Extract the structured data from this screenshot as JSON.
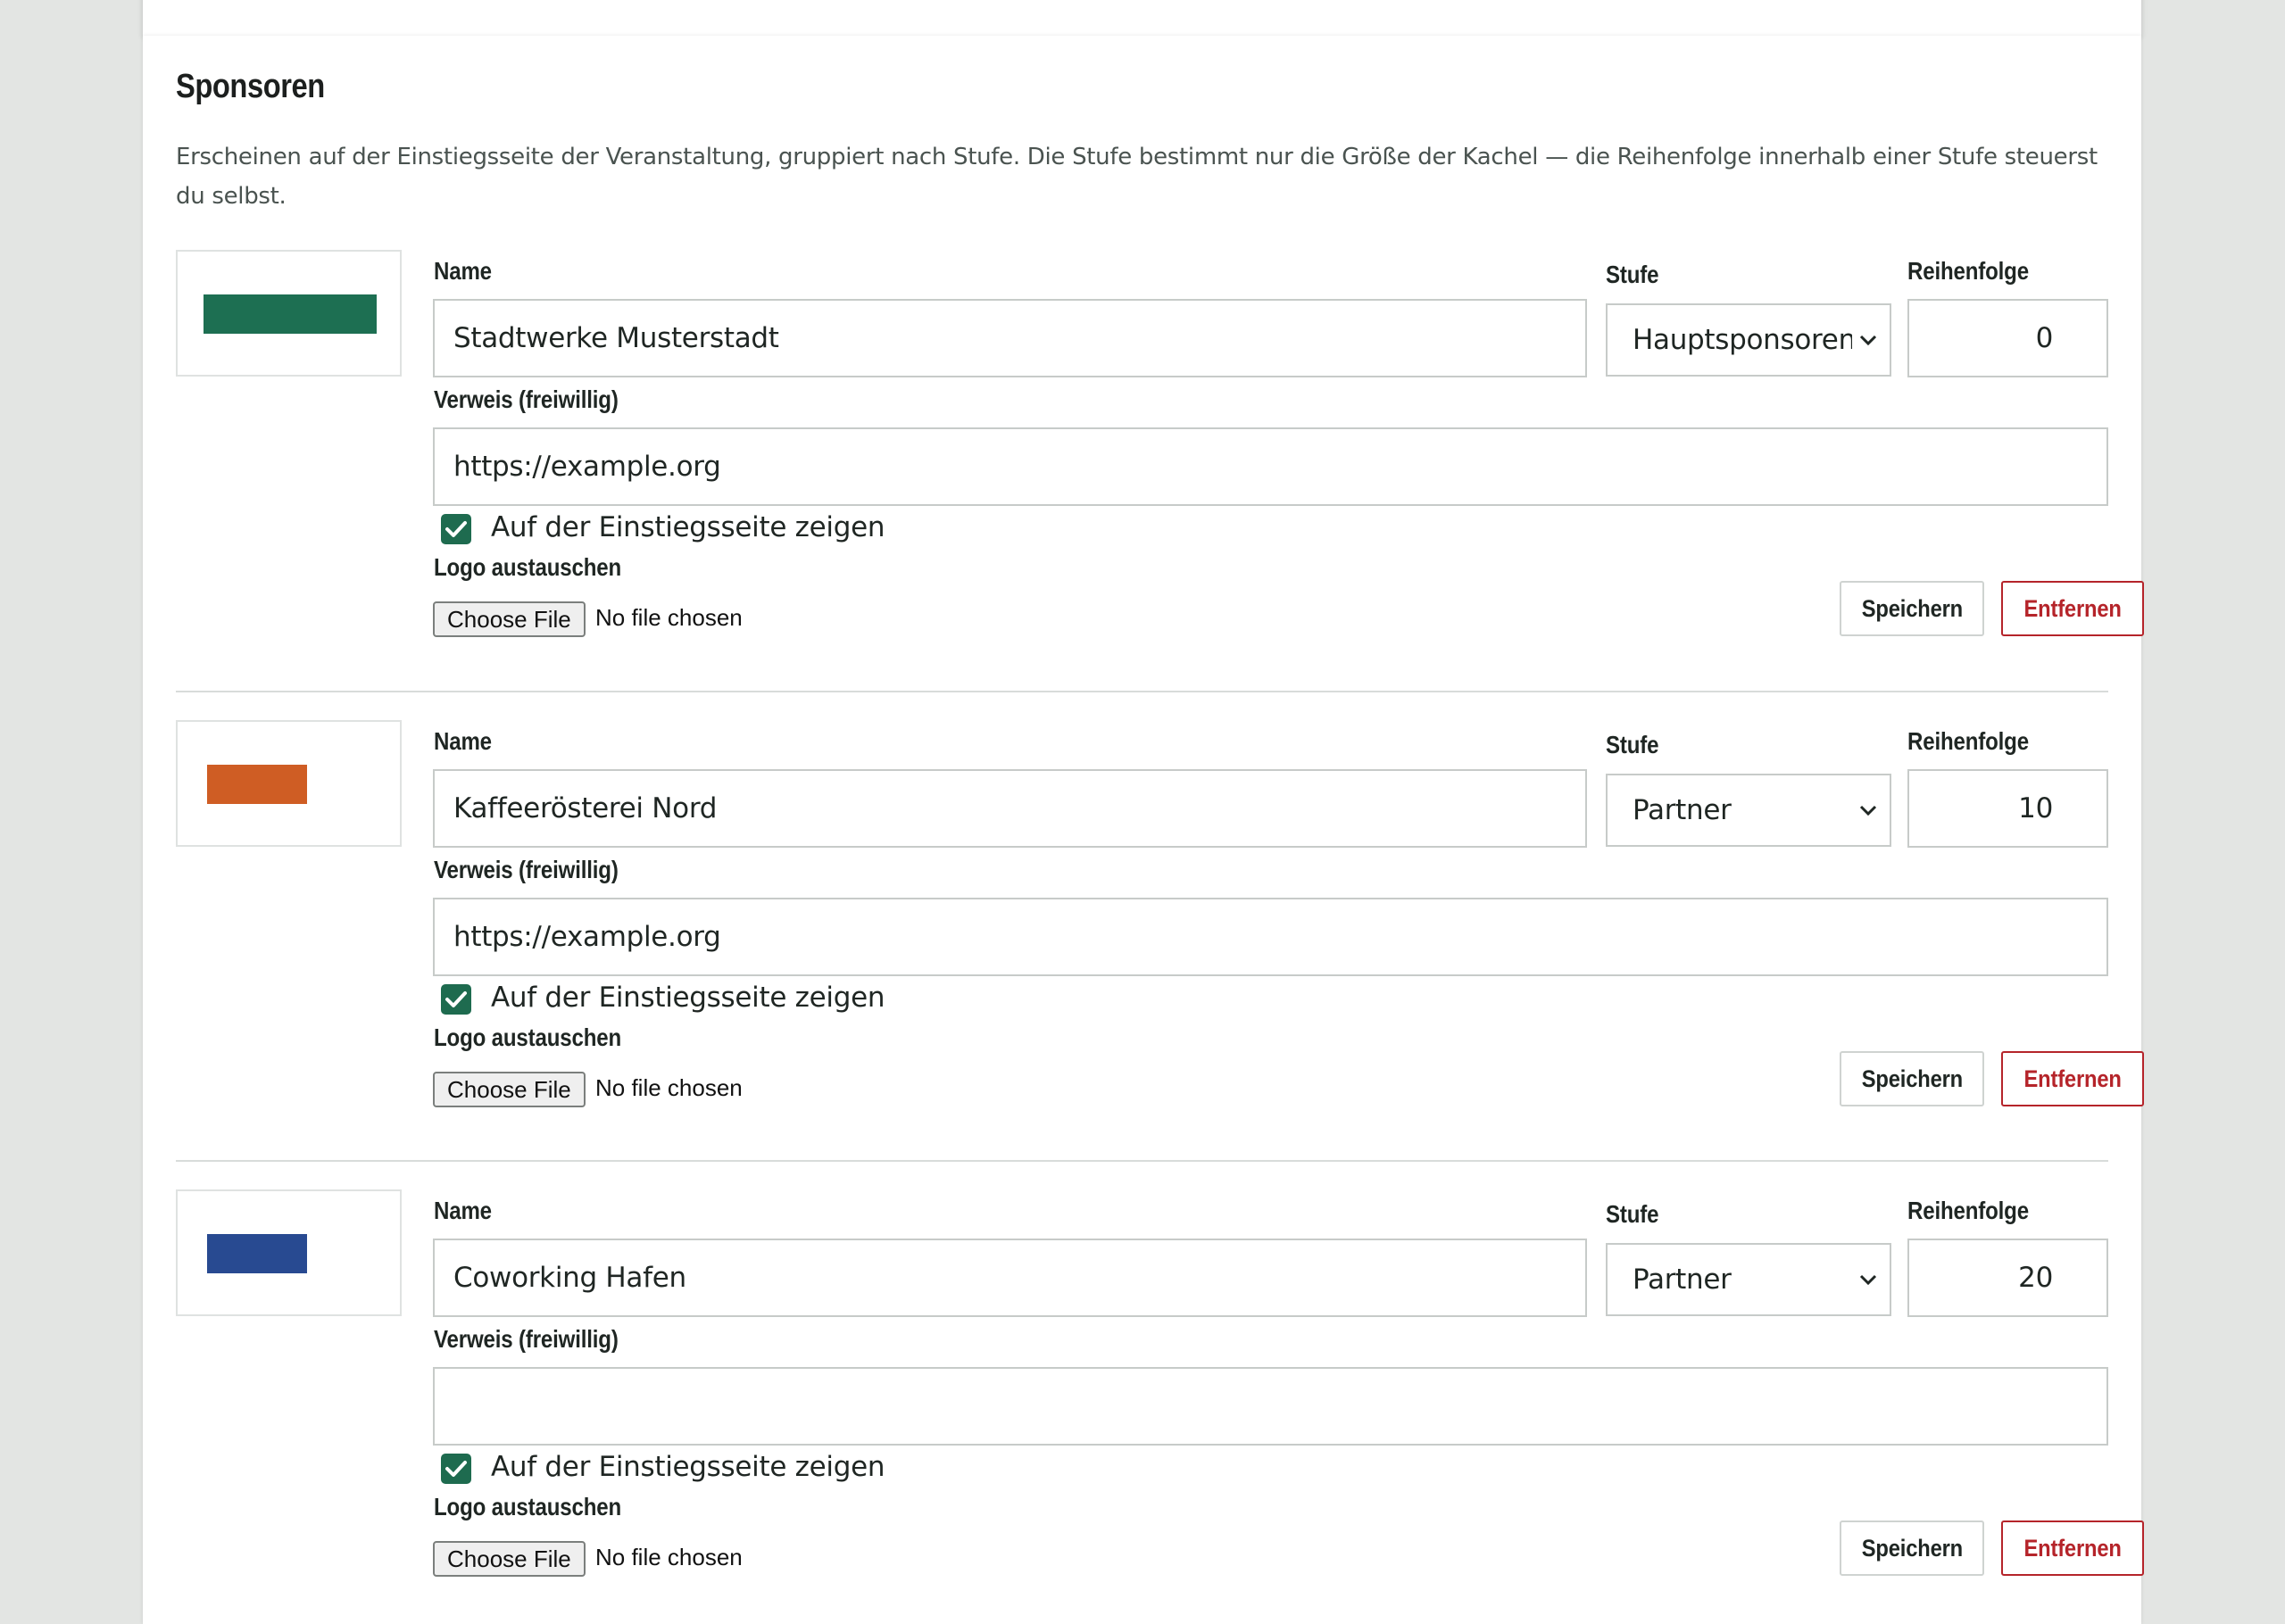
{
  "section": {
    "title": "Sponsoren",
    "description": "Erscheinen auf der Einstiegsseite der Veranstaltung, gruppiert nach Stufe. Die Stufe bestimmt nur die Größe der Kachel — die Reihenfolge innerhalb einer Stufe steuerst du selbst."
  },
  "labels": {
    "name": "Name",
    "tier": "Stufe",
    "order": "Reihenfolge",
    "link": "Verweis (freiwillig)",
    "show_on_landing": "Auf der Einstiegsseite zeigen",
    "replace_logo": "Logo austauschen",
    "choose_file": "Choose File",
    "no_file": "No file chosen",
    "save": "Speichern",
    "remove": "Entfernen"
  },
  "sponsors": [
    {
      "logo_color": "#1d6f52",
      "name": "Stadtwerke Musterstadt",
      "tier": "Hauptsponsoren",
      "order": "0",
      "link": "https://example.org",
      "show_on_landing": true
    },
    {
      "logo_color": "#cf5d24",
      "name": "Kaffeerösterei Nord",
      "tier": "Partner",
      "order": "10",
      "link": "https://example.org",
      "show_on_landing": true
    },
    {
      "logo_color": "#284a91",
      "name": "Coworking Hafen",
      "tier": "Partner",
      "order": "20",
      "link": "",
      "show_on_landing": true
    }
  ],
  "colors": {
    "accent": "#1e6b4f",
    "danger": "#b5242a",
    "background": "#e3e5e3"
  },
  "icons": {
    "checkbox": "check-icon",
    "select": "chevron-down-icon"
  }
}
